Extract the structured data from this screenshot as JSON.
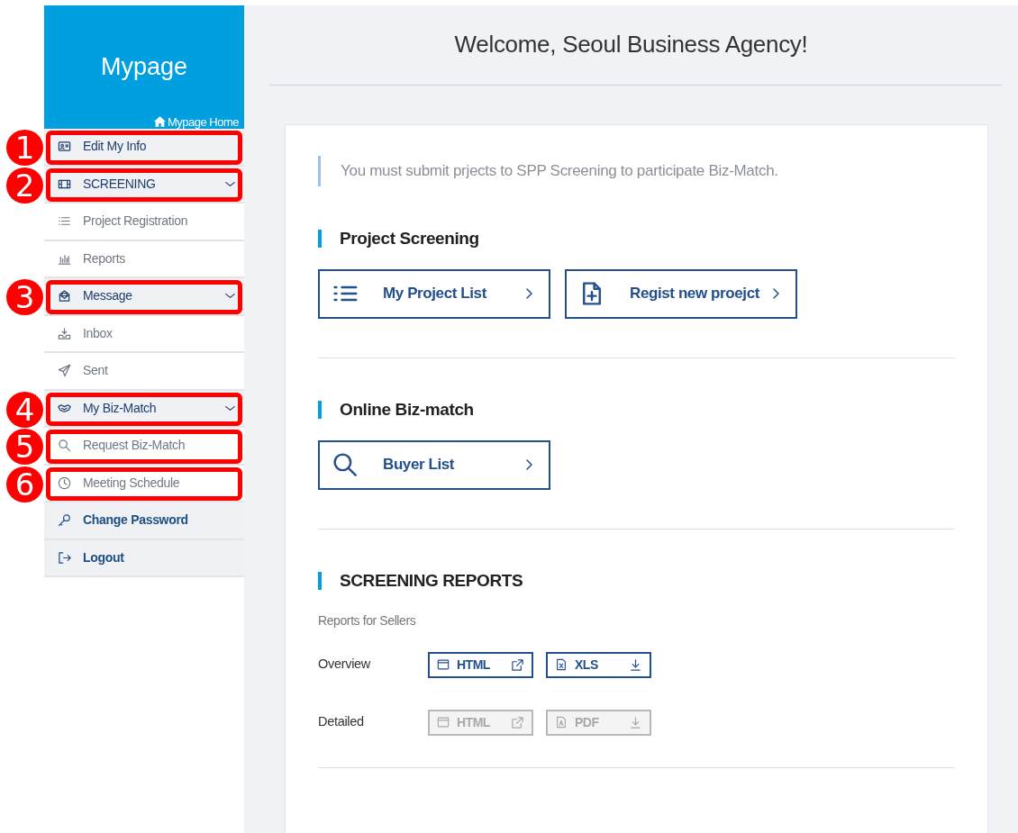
{
  "sidebar": {
    "title": "Mypage",
    "home_link": "Mypage Home",
    "items": [
      {
        "kind": "group",
        "label": "Edit My Info",
        "callout": "1"
      },
      {
        "kind": "group",
        "label": "SCREENING",
        "callout": "2",
        "expanded": true,
        "children": [
          {
            "label": "Project Registration"
          },
          {
            "label": "Reports"
          }
        ]
      },
      {
        "kind": "group",
        "label": "Message",
        "callout": "3",
        "expanded": true,
        "children": [
          {
            "label": "Inbox"
          },
          {
            "label": "Sent"
          }
        ]
      },
      {
        "kind": "group",
        "label": "My Biz-Match",
        "callout": "4",
        "expanded": true,
        "children": [
          {
            "label": "Request Biz-Match",
            "callout": "5"
          },
          {
            "label": "Meeting Schedule",
            "callout": "6"
          }
        ]
      },
      {
        "kind": "link",
        "label": "Change Password"
      },
      {
        "kind": "link",
        "label": "Logout"
      }
    ]
  },
  "main": {
    "title": "Welcome, Seoul Business Agency!",
    "notice": "You must submit prjects to SPP Screening to participate Biz-Match.",
    "sections": [
      {
        "kind": "buttons",
        "heading": "Project Screening",
        "buttons": [
          "My Project List",
          "Regist new proejct"
        ]
      },
      {
        "kind": "buttons",
        "heading": "Online Biz-match",
        "buttons": [
          "Buyer List"
        ]
      },
      {
        "kind": "reports",
        "heading": "SCREENING REPORTS",
        "subheading": "Reports for Sellers",
        "rows": [
          {
            "label": "Overview",
            "buttons": [
              {
                "label": "HTML",
                "kind": "web",
                "disabled": false
              },
              {
                "label": "XLS",
                "kind": "sheet",
                "disabled": false
              }
            ]
          },
          {
            "label": "Detailed",
            "buttons": [
              {
                "label": "HTML",
                "kind": "web",
                "disabled": true
              },
              {
                "label": "PDF",
                "kind": "document",
                "disabled": true
              }
            ]
          }
        ]
      }
    ]
  }
}
